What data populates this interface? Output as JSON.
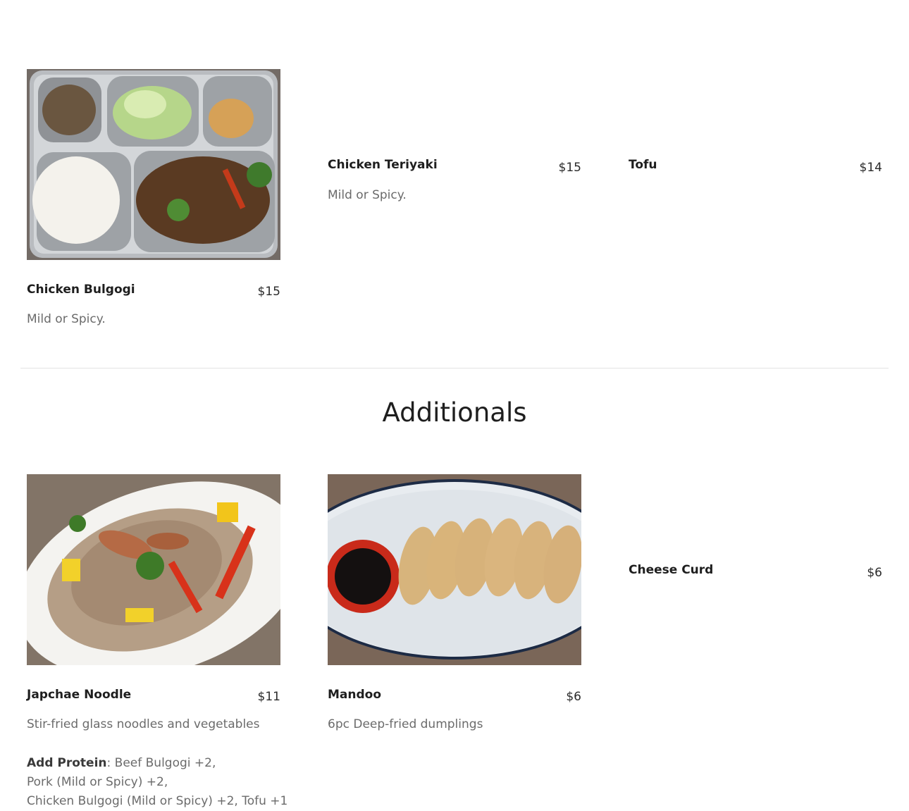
{
  "top_section": {
    "items": [
      {
        "name": "Chicken Bulgogi",
        "price": "$15",
        "description": "Mild or Spicy.",
        "has_photo": true
      },
      {
        "name": "Chicken Teriyaki",
        "price": "$15",
        "description": "Mild or Spicy.",
        "has_photo": false
      },
      {
        "name": "Tofu",
        "price": "$14",
        "description": "",
        "has_photo": false
      }
    ]
  },
  "additionals": {
    "title": "Additionals",
    "items": [
      {
        "name": "Japchae Noodle",
        "price": "$11",
        "description": "Stir-fried glass noodles and vegetables",
        "has_photo": true
      },
      {
        "name": "Mandoo",
        "price": "$6",
        "description": "6pc Deep-fried dumplings",
        "has_photo": true
      },
      {
        "name": "Cheese Curd",
        "price": "$6",
        "description": "",
        "has_photo": false
      }
    ],
    "add_protein": {
      "label": "Add Protein",
      "line1": ": Beef Bulgogi +2,",
      "line2": "Pork (Mild or Spicy) +2,",
      "line3": "Chicken Bulgogi (Mild or Spicy) +2, Tofu +1"
    }
  },
  "colors": {
    "text": "#1e1e1e",
    "muted": "#6b6b6b",
    "divider": "#e3e3e3"
  }
}
